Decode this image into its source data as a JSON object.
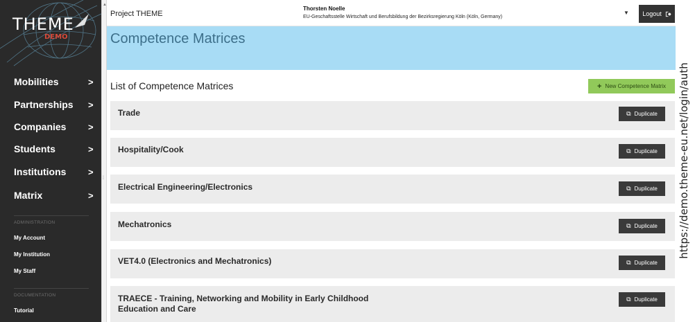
{
  "sidebar": {
    "logo_text": "THEME",
    "logo_sub": "DEMO",
    "nav_items": [
      {
        "label": "Mobilities",
        "icon": "chevron-right-icon"
      },
      {
        "label": "Partnerships",
        "icon": "chevron-right-icon"
      },
      {
        "label": "Companies",
        "icon": "chevron-right-icon"
      },
      {
        "label": "Students",
        "icon": "chevron-right-icon"
      },
      {
        "label": "Institutions",
        "icon": "chevron-right-icon"
      },
      {
        "label": "Matrix",
        "icon": "chevron-right-icon"
      }
    ],
    "chevron": ">",
    "admin_section": "ADMINISTRATION",
    "admin_links": [
      "My Account",
      "My Institution",
      "My Staff"
    ],
    "doc_section": "DOCUMENTATION",
    "doc_links": [
      "Tutorial"
    ]
  },
  "topbar": {
    "project": "Project THEME",
    "user_name": "Thorsten Noelle",
    "user_org": "EU-Geschaftsstelle Wirtschaft und Berufsbildung der Bezirksregierung Köln (Köln, Germany)",
    "logout_label": "Logout",
    "logout_icon": "sign-out-icon"
  },
  "header": {
    "title": "Competence Matrices"
  },
  "main": {
    "list_title": "List of Competence Matrices",
    "new_button_label": "New Competence Matrix",
    "new_button_icon": "plus-icon",
    "duplicate_label": "Duplicate",
    "duplicate_icon": "copy-icon",
    "matrices": [
      "Trade",
      "Hospitality/Cook",
      "Electrical Engineering/Electronics",
      "Mechatronics",
      "VET4.0 (Electronics and Mechatronics)",
      "TRAECE - Training, Networking and Mobility in Early Childhood Education and Care"
    ]
  },
  "url_caption": "https://demo.theme-eu.net/login/auth",
  "colors": {
    "sidebar_bg": "#2a2a2a",
    "header_bg": "#a8dcf5",
    "title_color": "#3d6f8a",
    "accent_green": "#91c95a",
    "row_bg": "#ececec",
    "button_dark": "#3a3a3a"
  }
}
